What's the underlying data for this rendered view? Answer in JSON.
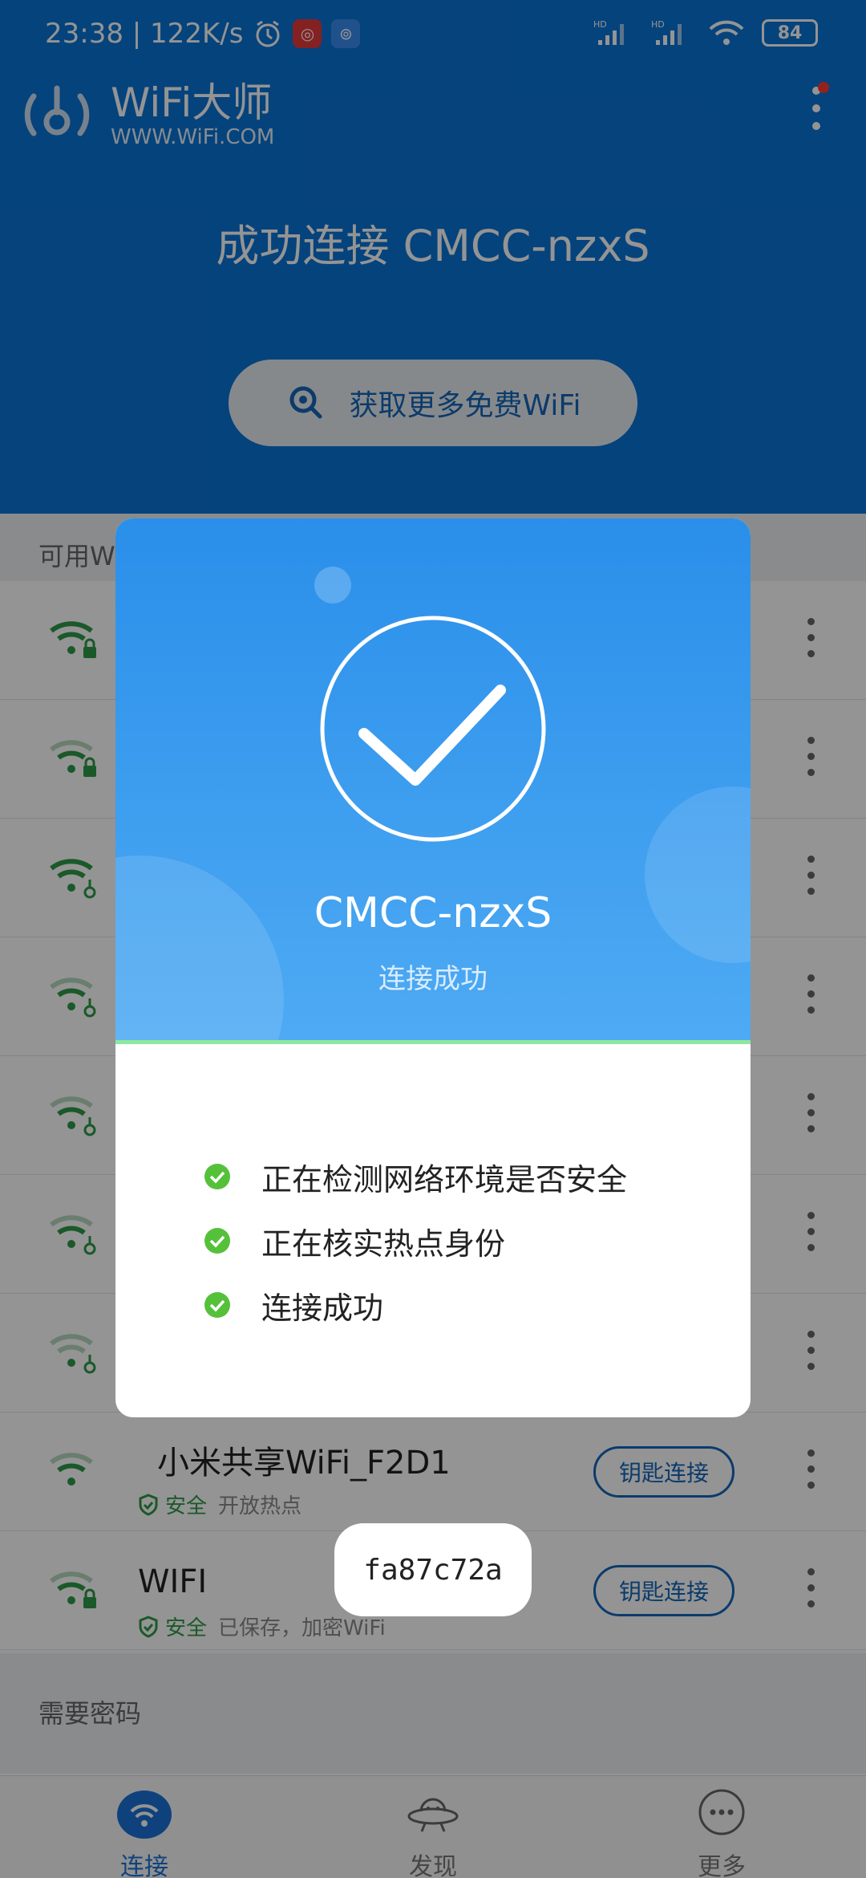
{
  "status_bar": {
    "time_speed": "23:38 | 122K/s",
    "signal1": "HD",
    "signal2": "HD",
    "battery": "84"
  },
  "app": {
    "title": "WiFi大师",
    "subtitle": "WWW.WiFi.COM"
  },
  "header": {
    "connected_title": "成功连接 CMCC-nzxS",
    "more_wifi_button": "获取更多免费WiFi"
  },
  "list": {
    "available_label": "可用WiFi",
    "password_label": "需要密码",
    "rows": [
      {
        "name": "",
        "safe": "",
        "desc": "",
        "button": ""
      },
      {
        "name": "",
        "safe": "",
        "desc": "",
        "button": ""
      },
      {
        "name": "",
        "safe": "",
        "desc": "",
        "button": ""
      },
      {
        "name": "",
        "safe": "",
        "desc": "",
        "button": ""
      },
      {
        "name": "",
        "safe": "",
        "desc": "",
        "button": ""
      },
      {
        "name": "",
        "safe": "",
        "desc": "",
        "button": ""
      },
      {
        "name": "",
        "safe": "",
        "desc": "",
        "button": ""
      },
      {
        "name": "小米共享WiFi_F2D1",
        "safe": "安全",
        "desc": "开放热点",
        "button": "钥匙连接"
      },
      {
        "name": "WIFI",
        "safe": "安全",
        "desc": "已保存，加密WiFi",
        "button": "钥匙连接"
      }
    ]
  },
  "dialog": {
    "ssid": "CMCC-nzxS",
    "status": "连接成功",
    "steps": [
      "正在检测网络环境是否安全",
      "正在核实热点身份",
      "连接成功"
    ]
  },
  "toast": {
    "text": "fa87c72a"
  },
  "tabs": [
    {
      "label": "连接",
      "icon": "wifi-icon",
      "active": true
    },
    {
      "label": "发现",
      "icon": "ufo-icon",
      "active": false
    },
    {
      "label": "更多",
      "icon": "more-icon",
      "active": false
    }
  ],
  "colors": {
    "brand_blue": "#0a74d6",
    "safe_green": "#2e9a47",
    "check_green": "#55c13a"
  }
}
